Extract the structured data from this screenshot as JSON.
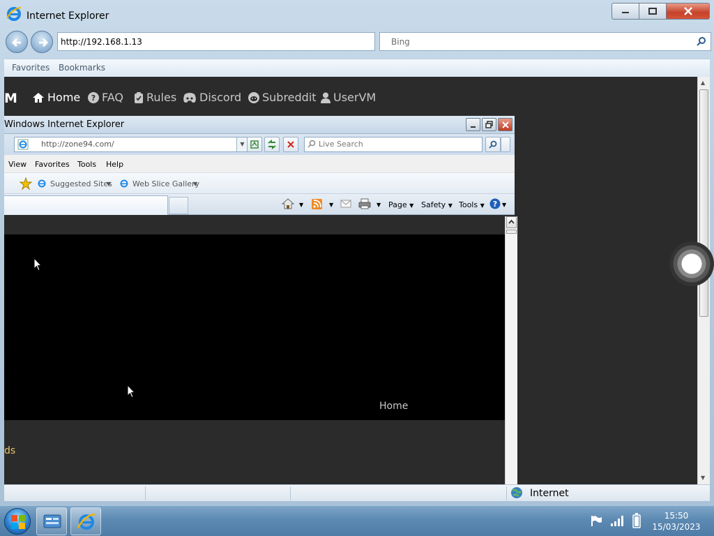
{
  "outer_window": {
    "title": "Internet Explorer",
    "address": "http://192.168.1.13",
    "search_placeholder": "Bing",
    "favorites_bar": [
      "Favorites",
      "Bookmarks"
    ]
  },
  "site_nav": {
    "logo_fragment": "M",
    "items": [
      "Home",
      "FAQ",
      "Rules",
      "Discord",
      "Subreddit",
      "UserVM"
    ]
  },
  "inner_window": {
    "title": "Windows Internet Explorer",
    "address": "http://zone94.com/",
    "search_placeholder": "Live Search",
    "menu": [
      "View",
      "Favorites",
      "Tools",
      "Help"
    ],
    "favorites": [
      "Suggested Sites",
      "Web Slice Gallery"
    ],
    "commands": [
      "Page",
      "Safety",
      "Tools"
    ],
    "page": {
      "home_link": "Home",
      "fragment": "ds"
    }
  },
  "status_bar": {
    "zone": "Internet"
  },
  "taskbar": {
    "time": "15:50",
    "date": "15/03/2023"
  }
}
